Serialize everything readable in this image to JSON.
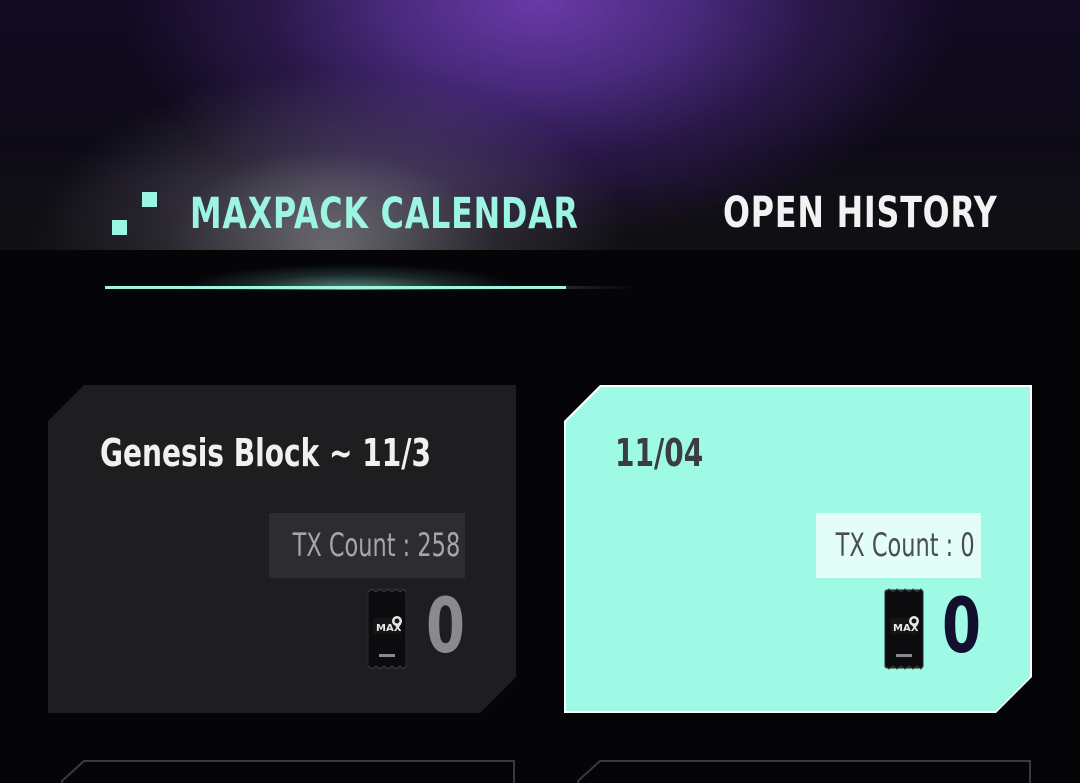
{
  "header": {
    "tabs": [
      {
        "label": "MAXPACK CALENDAR",
        "active": true
      },
      {
        "label": "OPEN HISTORY",
        "active": false
      }
    ],
    "accent_color": "#9bf5e2"
  },
  "cards": [
    {
      "title": "Genesis Block ~ 11/3",
      "tx_count": "TX Count : 258",
      "pack_count": "0",
      "pack_icon": "maxpack-pack-icon",
      "selected": false
    },
    {
      "title": "11/04",
      "tx_count": "TX Count : 0",
      "pack_count": "0",
      "pack_icon": "maxpack-pack-icon",
      "selected": true
    }
  ]
}
